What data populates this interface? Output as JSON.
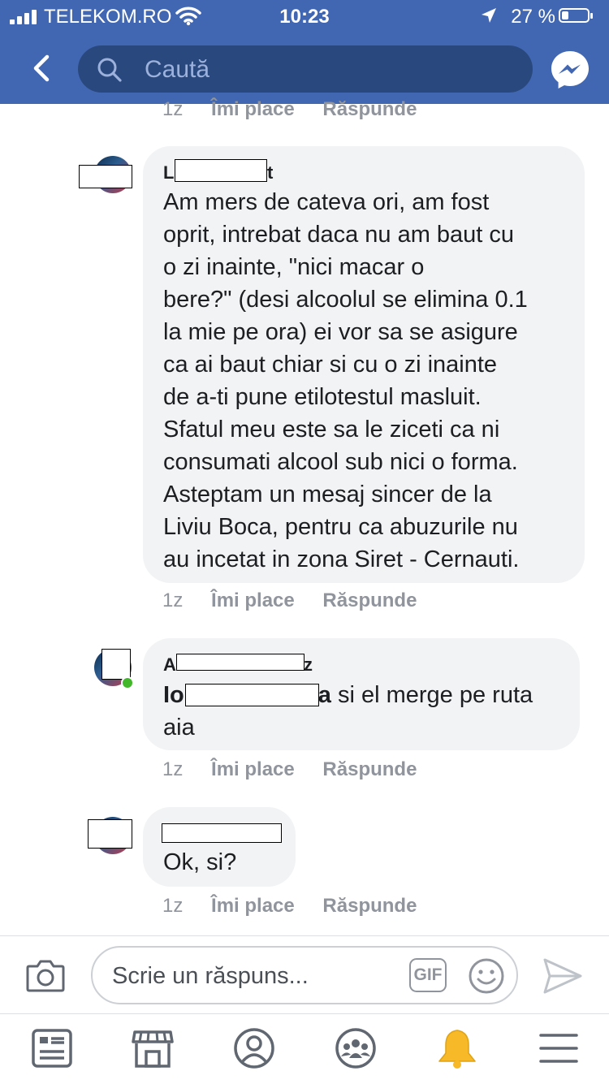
{
  "status_bar": {
    "carrier": "TELEKOM.RO",
    "time": "10:23",
    "battery": "27 %",
    "battery_level": 0.27
  },
  "header": {
    "search_placeholder": "Caută",
    "back_icon": "chevron-left-icon",
    "messenger_icon": "messenger-icon"
  },
  "comments": [
    {
      "time": "1z",
      "like": "Îmi place",
      "reply": "Răspunde"
    },
    {
      "author_start": "L",
      "author_end": "t",
      "lines": [
        "Am mers de cateva ori, am fost",
        "oprit, intrebat daca nu am baut cu",
        "o zi inainte, \"nici macar o",
        "bere?\" (desi alcoolul se elimina 0.1",
        "la mie pe ora) ei vor sa se asigure",
        "ca ai baut chiar si cu o zi inainte",
        "de a-ti pune  etilotestul masluit.",
        "Sfatul meu este sa le ziceti ca ni",
        "consumati alcool sub nici o forma.",
        "Asteptam un mesaj sincer de la",
        "Liviu Boca, pentru ca abuzurile nu",
        "au incetat in zona Siret - Cernauti."
      ],
      "time": "1z",
      "like": "Îmi place",
      "reply": "Răspunde"
    },
    {
      "author_start": "A",
      "author_end": "z",
      "mention_start": "Io",
      "mention_end": "a",
      "text_after_mention": " si el merge pe ruta",
      "line2": "aia",
      "time": "1z",
      "like": "Îmi place",
      "reply": "Răspunde"
    },
    {
      "text": "Ok, si?",
      "time": "1z",
      "like": "Îmi place",
      "reply": "Răspunde"
    }
  ],
  "reply_bar": {
    "placeholder": "Scrie un răspuns...",
    "gif_label": "GIF",
    "camera_icon": "camera-icon",
    "emoji_icon": "emoji-icon",
    "send_icon": "send-icon"
  },
  "tab_bar": {
    "items": [
      "news-feed-icon",
      "marketplace-icon",
      "profile-icon",
      "groups-icon",
      "notifications-icon",
      "menu-icon"
    ],
    "active": "notifications-icon",
    "accent_color": "#f7b928"
  },
  "colors": {
    "brand_blue": "#4267b2",
    "search_bg": "#29487d",
    "bubble_bg": "#f2f3f5",
    "meta_gray": "#90949c",
    "online_green": "#42b72a"
  }
}
